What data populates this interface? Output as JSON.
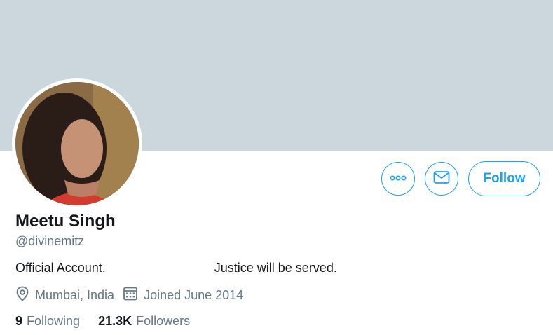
{
  "profile": {
    "name": "Meetu Singh",
    "handle": "@divinemitz",
    "bio": "Official Account.                               Justice will be served.",
    "location": "Mumbai, India",
    "joined": "Joined June 2014",
    "following_count": "9",
    "following_label": "Following",
    "followers_count": "21.3K",
    "followers_label": "Followers"
  },
  "actions": {
    "follow_label": "Follow",
    "more_icon": "more-icon",
    "message_icon": "envelope-icon"
  },
  "colors": {
    "banner": "#ccd6dd",
    "accent": "#1da1f2",
    "secondary_text": "#657786"
  }
}
